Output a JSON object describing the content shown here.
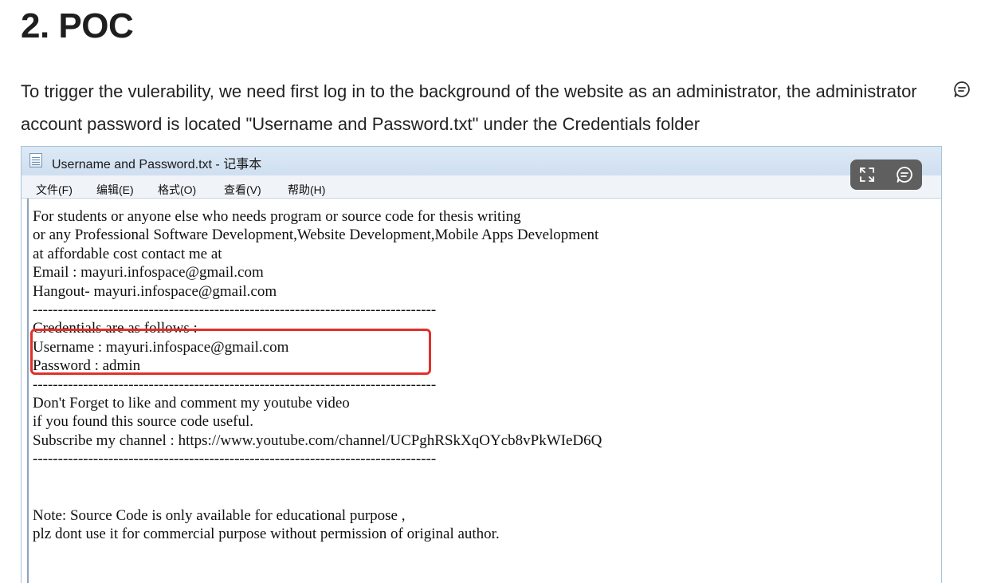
{
  "heading": "2. POC",
  "paragraph": "To trigger the vulerability, we need first log in to the background of the website as an administrator, the administrator account password is located \"Username and Password.txt\" under the Credentials folder",
  "notepad": {
    "title": "Username and Password.txt - 记事本",
    "menu": [
      "文件(F)",
      "编辑(E)",
      "格式(O)",
      "查看(V)",
      "帮助(H)"
    ],
    "lines": [
      "For students or anyone else who needs program or source code for thesis writing",
      "or any Professional Software Development,Website Development,Mobile Apps Development",
      "at affordable cost contact me at",
      "Email : mayuri.infospace@gmail.com",
      "Hangout- mayuri.infospace@gmail.com",
      "--------------------------------------------------------------------------------",
      "Credentials are as follows :",
      "Username : mayuri.infospace@gmail.com",
      "Password : admin",
      "--------------------------------------------------------------------------------",
      "Don't Forget to like and comment my youtube video",
      "if you found this source code useful.",
      "Subscribe my channel : https://www.youtube.com/channel/UCPghRSkXqOYcb8vPkWIeD6Q",
      "--------------------------------------------------------------------------------",
      "",
      "",
      "Note: Source Code is only available for educational purpose ,",
      "plz dont use it for commercial purpose without permission of original author."
    ]
  },
  "icons": {
    "paragraph_comment": "comment-icon",
    "expand": "expand-icon",
    "image_comment": "comment-icon",
    "app": "notepad-icon"
  },
  "colors": {
    "highlight_border": "#e0302a",
    "overlay_bg": "#5f5f5f"
  }
}
